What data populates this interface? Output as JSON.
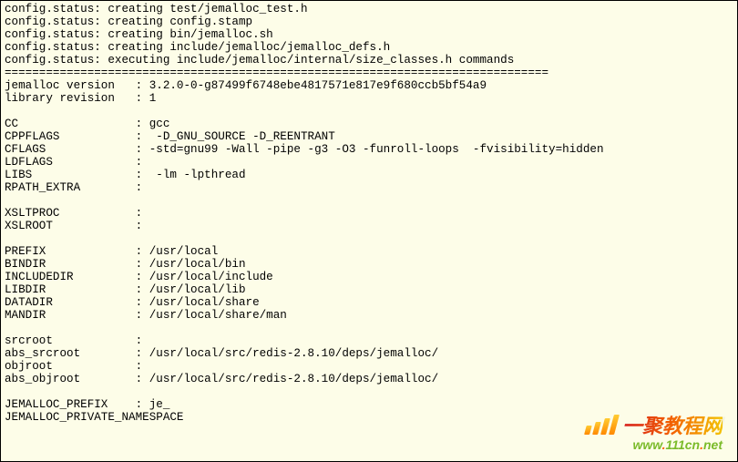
{
  "status_lines": [
    "config.status: creating test/jemalloc_test.h",
    "config.status: creating config.stamp",
    "config.status: creating bin/jemalloc.sh",
    "config.status: creating include/jemalloc/jemalloc_defs.h",
    "config.status: executing include/jemalloc/internal/size_classes.h commands"
  ],
  "separator": "===============================================================================",
  "kv_rows": [
    {
      "key": "jemalloc version  ",
      "value": "3.2.0-0-g87499f6748ebe4817571e817e9f680ccb5bf54a9"
    },
    {
      "key": "library revision  ",
      "value": "1"
    },
    {
      "key": "",
      "value": ""
    },
    {
      "key": "CC                ",
      "value": "gcc"
    },
    {
      "key": "CPPFLAGS          ",
      "value": " -D_GNU_SOURCE -D_REENTRANT"
    },
    {
      "key": "CFLAGS            ",
      "value": "-std=gnu99 -Wall -pipe -g3 -O3 -funroll-loops  -fvisibility=hidden"
    },
    {
      "key": "LDFLAGS           ",
      "value": ""
    },
    {
      "key": "LIBS              ",
      "value": " -lm -lpthread"
    },
    {
      "key": "RPATH_EXTRA       ",
      "value": ""
    },
    {
      "key": "",
      "value": ""
    },
    {
      "key": "XSLTPROC          ",
      "value": ""
    },
    {
      "key": "XSLROOT           ",
      "value": ""
    },
    {
      "key": "",
      "value": ""
    },
    {
      "key": "PREFIX            ",
      "value": "/usr/local"
    },
    {
      "key": "BINDIR            ",
      "value": "/usr/local/bin"
    },
    {
      "key": "INCLUDEDIR        ",
      "value": "/usr/local/include"
    },
    {
      "key": "LIBDIR            ",
      "value": "/usr/local/lib"
    },
    {
      "key": "DATADIR           ",
      "value": "/usr/local/share"
    },
    {
      "key": "MANDIR            ",
      "value": "/usr/local/share/man"
    },
    {
      "key": "",
      "value": ""
    },
    {
      "key": "srcroot           ",
      "value": ""
    },
    {
      "key": "abs_srcroot       ",
      "value": "/usr/local/src/redis-2.8.10/deps/jemalloc/"
    },
    {
      "key": "objroot           ",
      "value": ""
    },
    {
      "key": "abs_objroot       ",
      "value": "/usr/local/src/redis-2.8.10/deps/jemalloc/"
    },
    {
      "key": "",
      "value": ""
    },
    {
      "key": "JEMALLOC_PREFIX   ",
      "value": "je_"
    }
  ],
  "trailing_lines": [
    "JEMALLOC_PRIVATE_NAMESPACE"
  ],
  "watermark": {
    "title": "一聚教程网",
    "url_prefix": "www",
    "url_mid": "111cn",
    "url_suffix": "net"
  }
}
